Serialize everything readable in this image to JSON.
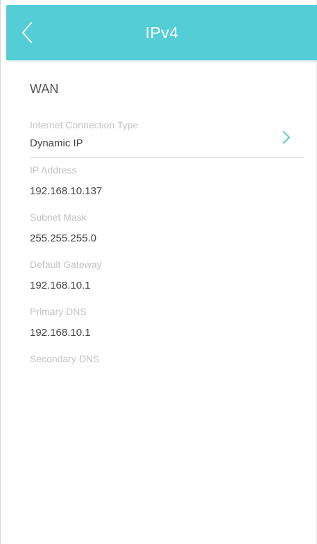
{
  "colors": {
    "header_bg": "#54cdd6",
    "accent": "#5ccbd4"
  },
  "header": {
    "title": "IPv4",
    "back_icon": "chevron-left-icon"
  },
  "section": {
    "title": "WAN"
  },
  "connection": {
    "label": "Internet Connection Type",
    "value": "Dynamic IP",
    "chevron_icon": "chevron-right-icon"
  },
  "fields": [
    {
      "label": "IP Address",
      "value": "192.168.10.137"
    },
    {
      "label": "Subnet Mask",
      "value": "255.255.255.0"
    },
    {
      "label": "Default Gateway",
      "value": "192.168.10.1"
    },
    {
      "label": "Primary DNS",
      "value": "192.168.10.1"
    },
    {
      "label": "Secondary DNS",
      "value": ""
    }
  ]
}
